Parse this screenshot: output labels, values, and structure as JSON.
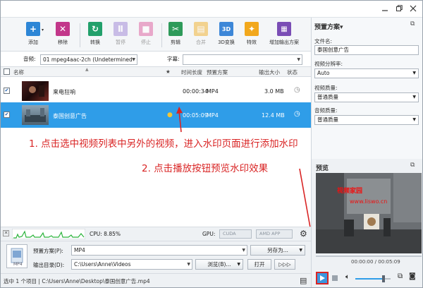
{
  "window": {
    "minimize_icon": "minimize-icon",
    "restore_icon": "restore-icon",
    "close_icon": "close-icon"
  },
  "toolbar": {
    "items": [
      {
        "label": "添加",
        "icon": "add-icon",
        "color": "#2d86d6",
        "glyph": "+"
      },
      {
        "label": "移除",
        "icon": "remove-icon",
        "color": "#c2378a",
        "glyph": "✕"
      },
      {
        "label": "转换",
        "icon": "convert-icon",
        "color": "#22a06b",
        "glyph": "↻"
      },
      {
        "label": "暂停",
        "icon": "pause-icon",
        "color": "#a58ed8",
        "glyph": "Ⅱ"
      },
      {
        "label": "停止",
        "icon": "stop-icon",
        "color": "#e06aa6",
        "glyph": "■"
      },
      {
        "label": "剪辑",
        "icon": "scissors-icon",
        "color": "#2e9a5a",
        "glyph": "✂"
      },
      {
        "label": "合并",
        "icon": "merge-icon",
        "color": "#f1b53b",
        "glyph": "▤"
      },
      {
        "label": "3D变换",
        "icon": "3d-icon",
        "color": "#3d87d8",
        "glyph": "3D"
      },
      {
        "label": "特效",
        "icon": "effects-icon",
        "color": "#f2a81d",
        "glyph": "✦"
      },
      {
        "label": "增加输出方案",
        "icon": "add-profile-icon",
        "color": "#7a4db5",
        "glyph": "▦"
      }
    ]
  },
  "selectors": {
    "audio_label": "音频:",
    "audio_value": "01 mpeg4aac-2ch (Undetermined",
    "subtitle_label": "字幕:"
  },
  "columns": {
    "name": "名称",
    "star": "★",
    "duration": "时间长度",
    "profile": "预置方案",
    "size": "输出大小",
    "status": "状态"
  },
  "files": [
    {
      "name": "来电狂响",
      "duration": "00:00:34",
      "profile": "MP4",
      "size": "3.0 MB",
      "checked": "✔"
    },
    {
      "name": "泰国创意广告",
      "duration": "00:05:09",
      "profile": "MP4",
      "size": "12.4 MB",
      "checked": "✔"
    }
  ],
  "annotations": {
    "step1": "1. 点击选中视频列表中另外的视频，进入水印页面进行添加水印",
    "step2": "2. 点击播放按钮预览水印效果"
  },
  "cpu": {
    "label": "CPU: 8.85%",
    "gpu_label": "GPU:",
    "cuda": "CUDA",
    "amd": "AMD APP"
  },
  "output": {
    "profile_label": "预置方案(P):",
    "profile_value": "MP4",
    "save_as": "另存为...",
    "dir_label": "输出目录(D):",
    "dir_value": "C:\\Users\\Anne\\Videos",
    "browse": "浏览(B)...",
    "open": "打开",
    "more": "▷▷▷"
  },
  "status": {
    "text": "选中 1 个项目 | C:\\Users\\Anne\\Desktop\\泰国创意广告.mp4"
  },
  "right_panel": {
    "title": "预置方案▾",
    "filename_label": "文件名:",
    "filename_value": "泰国创意广告",
    "resolution_label": "视频分辨率:",
    "resolution_value": "Auto",
    "video_quality_label": "视频质量:",
    "video_quality_value": "普通质量",
    "audio_quality_label": "音频质量:",
    "audio_quality_value": "普通质量"
  },
  "preview": {
    "title": "预览",
    "time": "00:00:00 / 00:05:09",
    "watermark_title": "视频家园",
    "watermark_url": "www.liswo.cn"
  },
  "colors": {
    "accent": "#2f9de8",
    "annotation": "#d92525"
  }
}
